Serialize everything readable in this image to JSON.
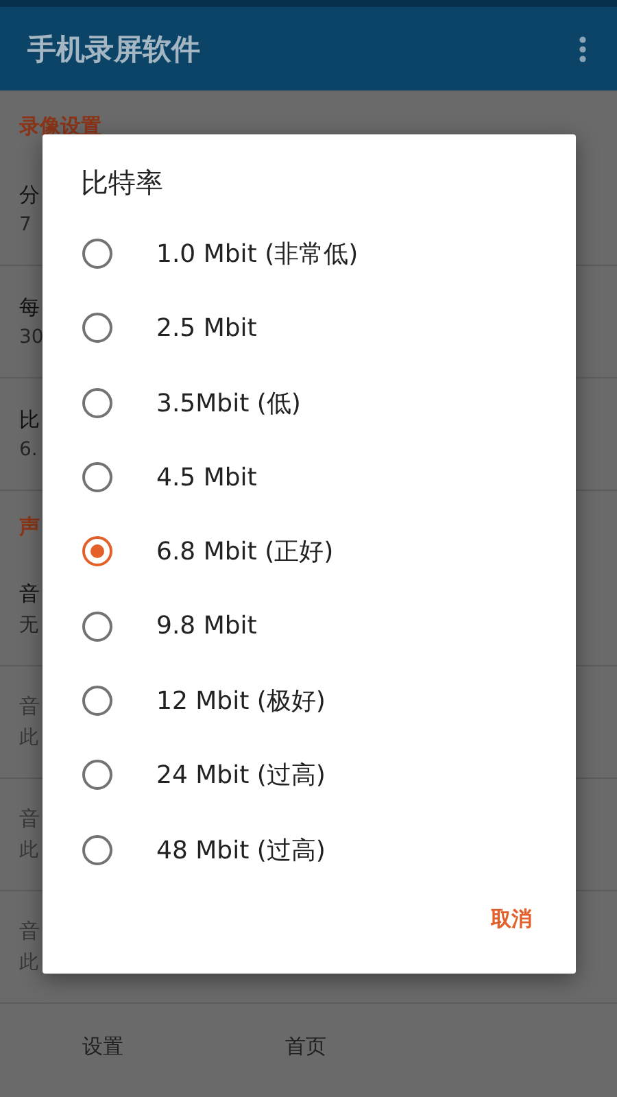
{
  "app_bar": {
    "title": "手机录屏软件"
  },
  "background": {
    "sections": [
      {
        "header": "录像设置",
        "items": [
          {
            "title": "分",
            "value": "7",
            "disabled": false
          },
          {
            "title": "每",
            "value": "30",
            "disabled": false
          },
          {
            "title": "比",
            "value": "6.",
            "disabled": false
          }
        ]
      },
      {
        "header": "声",
        "items": [
          {
            "title": "音",
            "value": "无",
            "disabled": false
          },
          {
            "title": "音",
            "value": "此",
            "disabled": true
          },
          {
            "title": "音",
            "value": "此",
            "disabled": true
          },
          {
            "title": "音",
            "value": "此",
            "disabled": true
          }
        ]
      }
    ]
  },
  "bottom_nav": [
    {
      "label": "设置"
    },
    {
      "label": "首页"
    }
  ],
  "dialog": {
    "title": "比特率",
    "options": [
      {
        "label": "1.0 Mbit (非常低)",
        "selected": false
      },
      {
        "label": "2.5 Mbit",
        "selected": false
      },
      {
        "label": "3.5Mbit (低)",
        "selected": false
      },
      {
        "label": "4.5 Mbit",
        "selected": false
      },
      {
        "label": "6.8 Mbit (正好)",
        "selected": true
      },
      {
        "label": "9.8 Mbit",
        "selected": false
      },
      {
        "label": "12 Mbit (极好)",
        "selected": false
      },
      {
        "label": "24 Mbit (过高)",
        "selected": false
      },
      {
        "label": "48 Mbit (过高)",
        "selected": false
      }
    ],
    "buttons": [
      "取消"
    ]
  }
}
